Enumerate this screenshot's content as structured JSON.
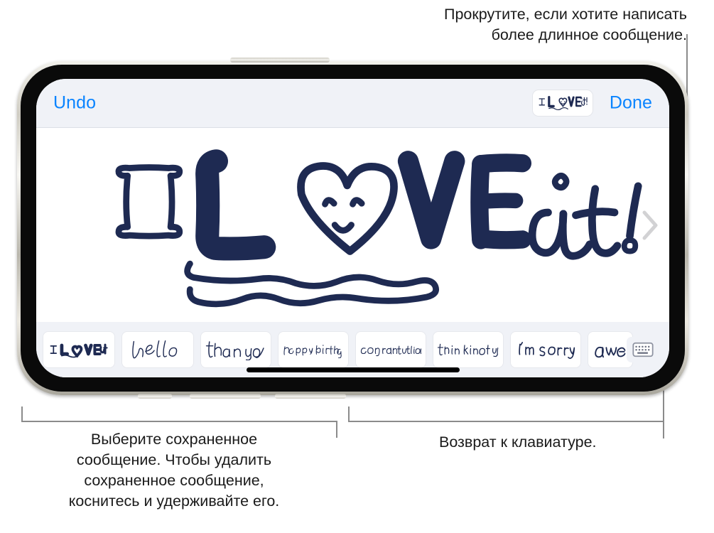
{
  "callouts": {
    "top": "Прокрутите, если хотите написать\nболее длинное сообщение.",
    "bottom_left": "Выберите сохраненное\nсообщение. Чтобы удалить\nсохраненное сообщение,\nкоснитесь и удерживайте его.",
    "bottom_right": "Возврат к клавиатуре."
  },
  "header": {
    "undo_label": "Undo",
    "done_label": "Done",
    "thumbnail_alt": "I LOVE it!"
  },
  "canvas": {
    "drawing_text": "I LOVE it!",
    "scroll_icon": "chevron-right-icon"
  },
  "saved_messages": {
    "items": [
      {
        "label": "I LOVE it!",
        "style": "bold-block",
        "width": 100
      },
      {
        "label": "hello",
        "style": "script",
        "width": 100
      },
      {
        "label": "thank you",
        "style": "print",
        "width": 98
      },
      {
        "label": "happy birthday",
        "style": "tiny-script",
        "width": 98
      },
      {
        "label": "congratulations",
        "style": "small-print",
        "width": 98
      },
      {
        "label": "thinking of you",
        "style": "small-print",
        "width": 98
      },
      {
        "label": "I'm sorry",
        "style": "print",
        "width": 98
      },
      {
        "label": "awe",
        "style": "script",
        "width": 62
      }
    ],
    "keyboard_button_icon": "keyboard-icon"
  },
  "colors": {
    "accent_blue": "#0a84ff",
    "ink_navy": "#1e2a52",
    "bar_gray": "#f0f2f7",
    "callout_line": "#8b8b8b"
  }
}
